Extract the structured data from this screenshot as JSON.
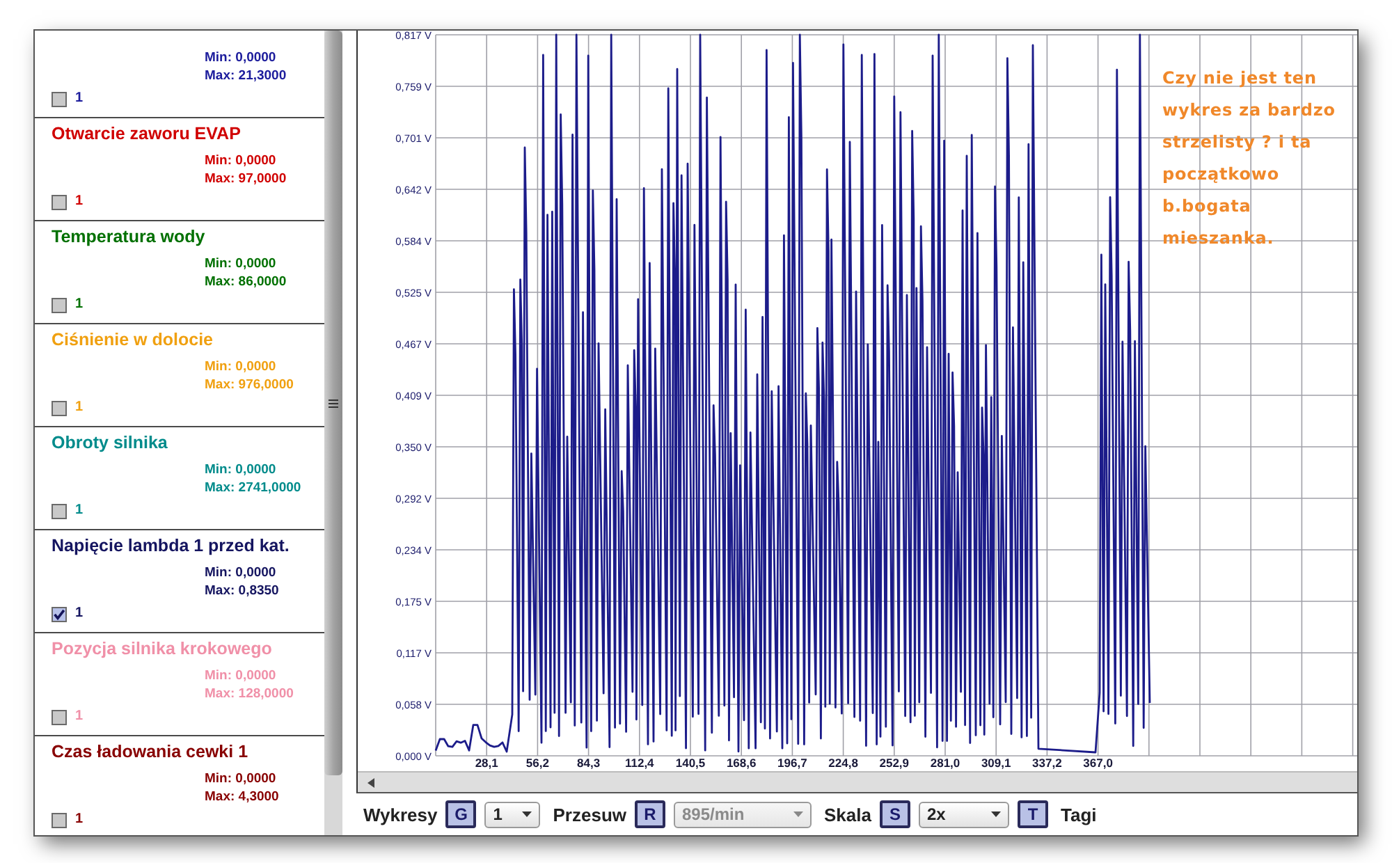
{
  "channels": [
    {
      "min": "Min: 0,0000",
      "max": "Max: 21,3000",
      "color": "#1c1c9c",
      "checked": false,
      "label": "1"
    },
    {
      "name": "Otwarcie zaworu EVAP",
      "min": "Min: 0,0000",
      "max": "Max: 97,0000",
      "color": "#d00000",
      "checked": false,
      "label": "1"
    },
    {
      "name": "Temperatura wody",
      "min": "Min: 0,0000",
      "max": "Max: 86,0000",
      "color": "#007000",
      "checked": false,
      "label": "1"
    },
    {
      "name": "Ciśnienie w dolocie",
      "min": "Min: 0,0000",
      "max": "Max: 976,0000",
      "color": "#f0a010",
      "checked": false,
      "label": "1"
    },
    {
      "name": "Obroty silnika",
      "min": "Min: 0,0000",
      "max": "Max: 2741,0000",
      "color": "#008b8b",
      "checked": false,
      "label": "1"
    },
    {
      "name": "Napięcie lambda 1 przed kat.",
      "min": "Min: 0,0000",
      "max": "Max: 0,8350",
      "color": "#151560",
      "checked": true,
      "label": "1"
    },
    {
      "name": "Pozycja silnika krokowego",
      "min": "Min: 0,0000",
      "max": "Max: 128,0000",
      "color": "#f090a8",
      "checked": false,
      "label": "1"
    },
    {
      "name": "Czas ładowania cewki 1",
      "min": "Min: 0,0000",
      "max": "Max: 4,3000",
      "color": "#880000",
      "checked": false,
      "label": "1"
    }
  ],
  "chart": {
    "y_labels": [
      "0,817 V",
      "0,759 V",
      "0,701 V",
      "0,642 V",
      "0,584 V",
      "0,525 V",
      "0,467 V",
      "0,409 V",
      "0,350 V",
      "0,292 V",
      "0,234 V",
      "0,175 V",
      "0,117 V",
      "0,058 V",
      "0,000 V"
    ],
    "x_labels": [
      "28,1",
      "56,2",
      "84,3",
      "112,4",
      "140,5",
      "168,6",
      "196,7",
      "224,8",
      "252,9",
      "281,0",
      "309,1",
      "337,2",
      "367,0"
    ],
    "note": "Czy nie jest ten\nwykres za bardzo\nstrzelisty ? i ta\npoczątkowo\nb.bogata\nmieszanka."
  },
  "toolbar": [
    {
      "kind": "label",
      "text": "Wykresy"
    },
    {
      "kind": "key",
      "text": "G"
    },
    {
      "kind": "dropdown",
      "text": "1",
      "disabled": false
    },
    {
      "kind": "label",
      "text": "Przesuw"
    },
    {
      "kind": "key",
      "text": "R"
    },
    {
      "kind": "dropdown",
      "text": "895/min",
      "disabled": true
    },
    {
      "kind": "label",
      "text": "Skala"
    },
    {
      "kind": "key",
      "text": "S"
    },
    {
      "kind": "dropdown",
      "text": "2x",
      "disabled": false
    },
    {
      "kind": "key",
      "text": "T"
    },
    {
      "kind": "label",
      "text": "Tagi"
    }
  ]
}
